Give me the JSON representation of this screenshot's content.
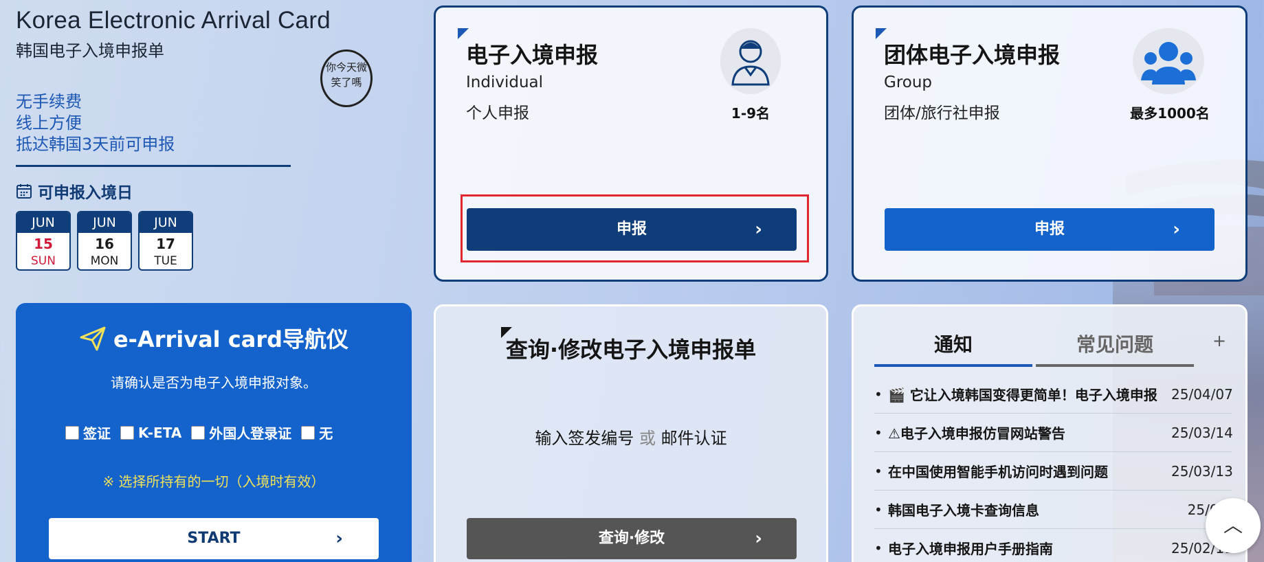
{
  "header": {
    "title_en": "Korea Electronic Arrival Card",
    "title_cn": "韩国电子入境申报单",
    "features": [
      "无手续费",
      "线上方便",
      "抵达韩国3天前可申报"
    ],
    "stamp_text": "你今天微笑了嗎"
  },
  "dates_section": {
    "label": "可申报入境日",
    "dates": [
      {
        "month": "JUN",
        "day": "15",
        "weekday": "SUN"
      },
      {
        "month": "JUN",
        "day": "16",
        "weekday": "MON"
      },
      {
        "month": "JUN",
        "day": "17",
        "weekday": "TUE"
      }
    ]
  },
  "individual": {
    "title": "电子入境申报",
    "sub_en": "Individual",
    "sub_cn": "个人申报",
    "capacity": "1-9名",
    "button": "申报"
  },
  "group": {
    "title": "团体电子入境申报",
    "sub_en": "Group",
    "sub_cn": "团体/旅行社申报",
    "capacity": "最多1000名",
    "button": "申报"
  },
  "navigator": {
    "title": "e-Arrival card导航仪",
    "subtitle": "请确认是否为电子入境申报对象。",
    "options": [
      "签证",
      "K-ETA",
      "外国人登录证",
      "无"
    ],
    "note": "※ 选择所持有的一切（入境时有效）",
    "start": "START"
  },
  "query": {
    "title": "查询·修改电子入境申报单",
    "line_a": "输入签发编号",
    "or": "或",
    "line_b": "邮件认证",
    "button": "查询·修改"
  },
  "notices": {
    "tab_active": "通知",
    "tab_other": "常见问题",
    "plus": "+",
    "items": [
      {
        "title": "🎬 它让入境韩国变得更简单！电子入境申报",
        "date": "25/04/07"
      },
      {
        "title": "⚠电子入境申报仿冒网站警告",
        "date": "25/03/14"
      },
      {
        "title": "在中国使用智能手机访问时遇到问题",
        "date": "25/03/13"
      },
      {
        "title": "韩国电子入境卡查询信息",
        "date": "25/02/"
      },
      {
        "title": "电子入境申报用户手册指南",
        "date": "25/02/11"
      }
    ]
  },
  "colors": {
    "brand_dark": "#0e3d79",
    "brand_blue": "#1463cc",
    "highlight": "#e3262e"
  }
}
